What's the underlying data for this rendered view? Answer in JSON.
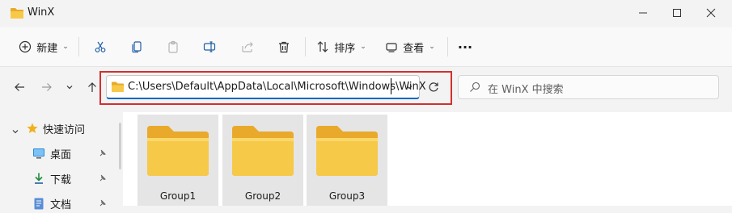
{
  "window": {
    "title": "WinX"
  },
  "toolbar": {
    "new_label": "新建",
    "sort_label": "排序",
    "view_label": "查看",
    "more_label": "···"
  },
  "address": {
    "path": "C:\\Users\\Default\\AppData\\Local\\Microsoft\\Windows\\WinX"
  },
  "search": {
    "placeholder": "在 WinX 中搜索"
  },
  "sidebar": {
    "items": [
      {
        "label": "快速访问",
        "icon": "star-icon"
      },
      {
        "label": "桌面",
        "icon": "desktop-icon"
      },
      {
        "label": "下载",
        "icon": "download-icon"
      },
      {
        "label": "文档",
        "icon": "document-icon"
      }
    ]
  },
  "files": [
    {
      "name": "Group1"
    },
    {
      "name": "Group2"
    },
    {
      "name": "Group3"
    }
  ],
  "colors": {
    "accent": "#0067c0",
    "highlight": "#d32f2f",
    "folder": "#f7c948",
    "star": "#f2b01e"
  }
}
